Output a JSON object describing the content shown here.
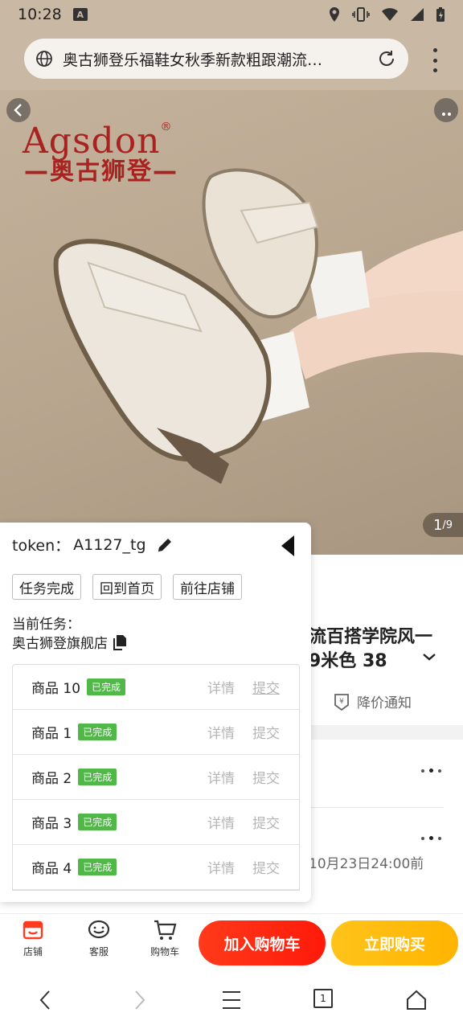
{
  "status_bar": {
    "time": "10:28",
    "notification_letter": "A"
  },
  "browser": {
    "page_title": "奥古狮登乐福鞋女秋季新款粗跟潮流…"
  },
  "hero": {
    "brand_en": "Agsdon",
    "brand_reg": "®",
    "brand_cn": "—奥古狮登—",
    "pager_current": "1",
    "pager_total": "/9"
  },
  "product": {
    "title_line1": "流百搭学院风一",
    "title_line2": "9米色 38",
    "price_notify": "降价通知",
    "deadline": "10月23日24:00前"
  },
  "panel": {
    "token_label": "token：",
    "token_value": "A1127_tg",
    "buttons": [
      "任务完成",
      "回到首页",
      "前往店铺"
    ],
    "task_label": "当前任务：",
    "task_shop": "奥古狮登旗舰店",
    "goods": [
      {
        "name": "商品 10",
        "status": "已完成",
        "detail": "详情",
        "submit": "提交"
      },
      {
        "name": "商品 1",
        "status": "已完成",
        "detail": "详情",
        "submit": "提交"
      },
      {
        "name": "商品 2",
        "status": "已完成",
        "detail": "详情",
        "submit": "提交"
      },
      {
        "name": "商品 3",
        "status": "已完成",
        "detail": "详情",
        "submit": "提交"
      },
      {
        "name": "商品 4",
        "status": "已完成",
        "detail": "详情",
        "submit": "提交"
      }
    ]
  },
  "bottom_bar": {
    "shop": "店铺",
    "service": "客服",
    "cart": "购物车",
    "add_cart": "加入购物车",
    "buy_now": "立即购买"
  },
  "nav": {
    "tab_count": "1"
  },
  "colors": {
    "brand_red": "#a82320",
    "done_green": "#52b749",
    "cart_red": "#ff2a12",
    "buy_yellow": "#ffbc0d",
    "shop_icon_red": "#ff3b1f"
  },
  "icons": [
    "globe-icon",
    "reload-icon",
    "back-arrow-icon",
    "more-icon",
    "edit-icon",
    "collapse-triangle-icon",
    "copy-icon",
    "price-tag-icon",
    "chevron-down-icon",
    "shop-icon",
    "service-icon",
    "cart-icon",
    "nav-back-icon",
    "nav-forward-icon",
    "nav-menu-icon",
    "nav-tabs-icon",
    "nav-home-icon"
  ]
}
